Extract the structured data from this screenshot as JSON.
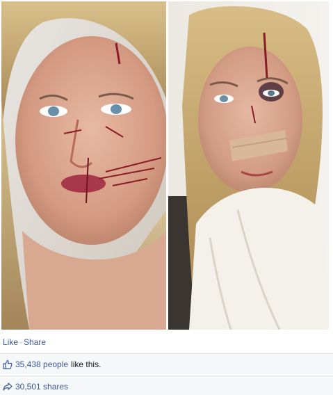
{
  "post": {
    "photos": [
      {
        "description": "left-photo"
      },
      {
        "description": "right-photo"
      }
    ],
    "actions": {
      "like_label": "Like",
      "separator": "·",
      "share_label": "Share"
    },
    "likes": {
      "count_text": "35,438 people",
      "suffix": "like this."
    },
    "shares": {
      "count_text": "30,501 shares"
    }
  },
  "colors": {
    "link": "#3b5998",
    "ufi_background": "#f6f7f8",
    "border": "#e1e2e3"
  }
}
